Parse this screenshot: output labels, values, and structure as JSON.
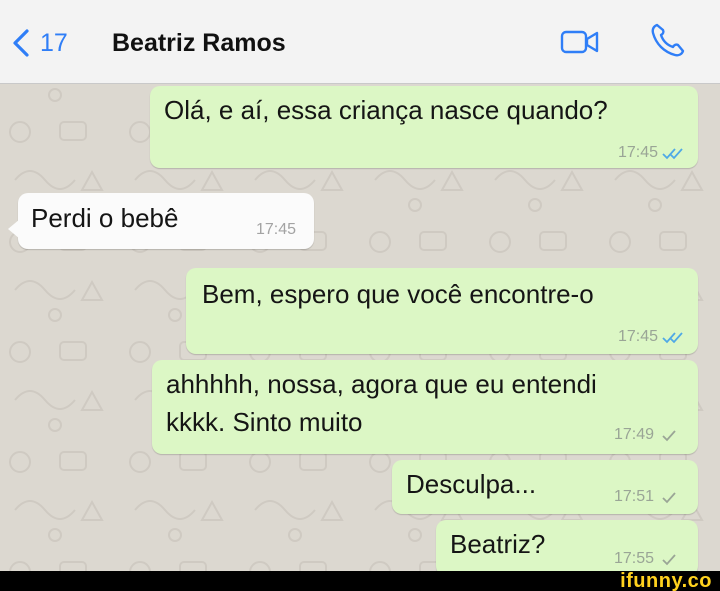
{
  "header": {
    "unread_count": "17",
    "contact_name": "Beatriz Ramos"
  },
  "messages": [
    {
      "direction": "out",
      "text": "Olá, e aí, essa criança nasce quando?",
      "time": "17:45",
      "status": "read"
    },
    {
      "direction": "in",
      "text": "Perdi o bebê",
      "time": "17:45"
    },
    {
      "direction": "out",
      "text": "Bem, espero que você encontre-o",
      "time": "17:45",
      "status": "read"
    },
    {
      "direction": "out",
      "text_line1": "ahhhhh, nossa, agora que eu entendi",
      "text_line2": "kkkk. Sinto muito",
      "time": "17:49",
      "status": "sent"
    },
    {
      "direction": "out",
      "text": "Desculpa...",
      "time": "17:51",
      "status": "sent"
    },
    {
      "direction": "out",
      "text": "Beatriz?",
      "time": "17:55",
      "status": "sent"
    }
  ],
  "watermark": "ifunny.co",
  "colors": {
    "outgoing_bubble": "#dcf7c5",
    "incoming_bubble": "#fbfbfb",
    "read_tick": "#4fa9e6",
    "ios_blue": "#2f7ef7"
  }
}
